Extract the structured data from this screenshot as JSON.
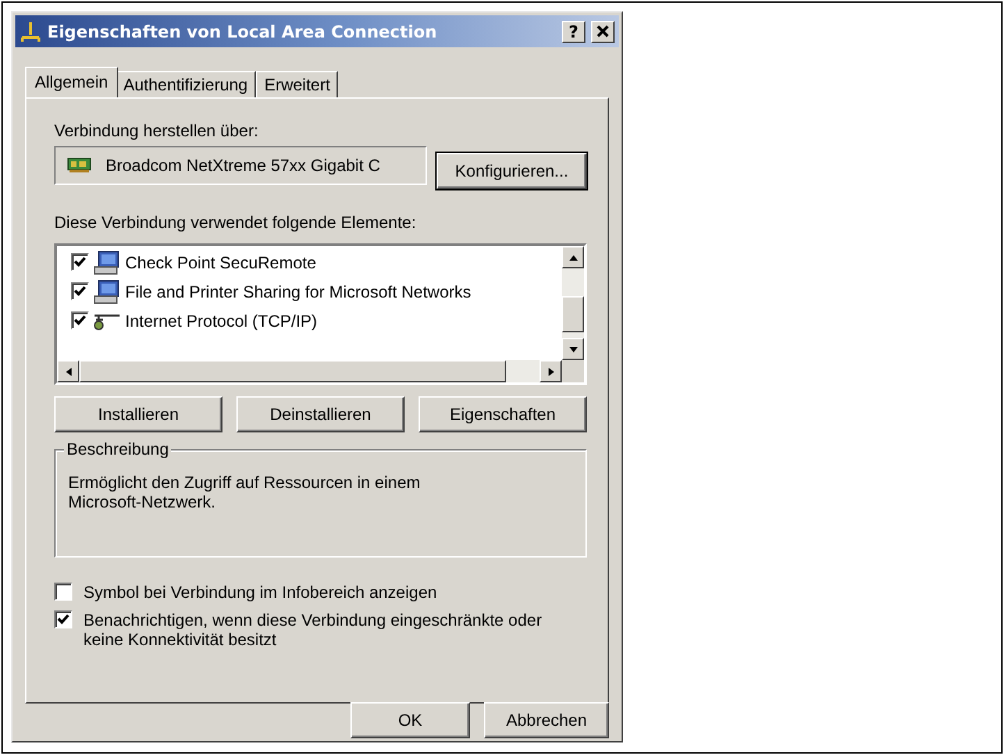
{
  "window": {
    "title": "Eigenschaften von Local Area Connection",
    "help_button": "?"
  },
  "tabs": [
    {
      "label": "Allgemein",
      "selected": true
    },
    {
      "label": "Authentifizierung",
      "selected": false
    },
    {
      "label": "Erweitert",
      "selected": false
    }
  ],
  "connect_label": "Verbindung herstellen über:",
  "adapter": "Broadcom NetXtreme 57xx Gigabit C",
  "configure_button": "Konfigurieren...",
  "components_label": "Diese Verbindung verwendet folgende Elemente:",
  "components": [
    {
      "label": "Check Point SecuRemote",
      "checked": true,
      "kind": "service"
    },
    {
      "label": "File and Printer Sharing for Microsoft Networks",
      "checked": true,
      "kind": "service"
    },
    {
      "label": "Internet Protocol (TCP/IP)",
      "checked": true,
      "kind": "protocol"
    }
  ],
  "component_buttons": [
    "Installieren",
    "Deinstallieren",
    "Eigenschaften"
  ],
  "description": {
    "legend": "Beschreibung",
    "text": "Ermöglicht den Zugriff auf Ressourcen in einem Microsoft-Netzwerk."
  },
  "options": [
    {
      "label": "Symbol bei Verbindung im Infobereich anzeigen",
      "checked": false
    },
    {
      "label": "Benachrichtigen, wenn diese Verbindung eingeschränkte oder keine Konnektivität besitzt",
      "checked": true
    }
  ],
  "dialog_buttons": [
    "OK",
    "Abbrechen"
  ]
}
